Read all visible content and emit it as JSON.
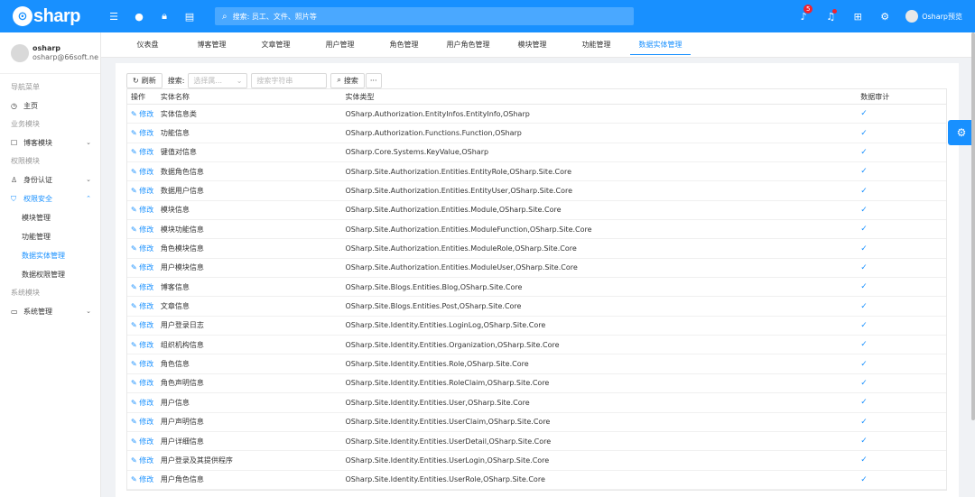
{
  "brand": {
    "logo_letter": "⊙",
    "name": "sharp"
  },
  "topbar": {
    "search_placeholder": "搜索: 员工、文件、照片等",
    "notification_count": "5",
    "user_name": "Osharp预览"
  },
  "sidebar": {
    "user": {
      "name": "osharp",
      "email": "osharp@66soft.ne"
    },
    "groups": {
      "nav": "导航菜单",
      "business": "业务模块",
      "permission": "权限模块",
      "system": "系统模块"
    },
    "items": {
      "home": "主页",
      "blog": "博客模块",
      "auth": "身份认证",
      "security": "权限安全",
      "system": "系统管理"
    },
    "sub_items": [
      "模块管理",
      "功能管理",
      "数据实体管理",
      "数据权限管理"
    ]
  },
  "tabs": [
    "仪表盘",
    "博客管理",
    "文章管理",
    "用户管理",
    "角色管理",
    "用户角色管理",
    "模块管理",
    "功能管理",
    "数据实体管理"
  ],
  "toolbar": {
    "refresh": "刷新",
    "search_label": "搜索:",
    "select_placeholder": "选择属...",
    "input_placeholder": "搜索字符串",
    "search_button": "搜索",
    "more": "···"
  },
  "table": {
    "headers": {
      "op": "操作",
      "name": "实体名称",
      "type": "实体类型",
      "audit": "数据审计"
    },
    "edit_label": "修改",
    "rows": [
      {
        "name": "实体信息类",
        "type": "OSharp.Authorization.EntityInfos.EntityInfo,OSharp"
      },
      {
        "name": "功能信息",
        "type": "OSharp.Authorization.Functions.Function,OSharp"
      },
      {
        "name": "键值对信息",
        "type": "OSharp.Core.Systems.KeyValue,OSharp"
      },
      {
        "name": "数据角色信息",
        "type": "OSharp.Site.Authorization.Entities.EntityRole,OSharp.Site.Core"
      },
      {
        "name": "数据用户信息",
        "type": "OSharp.Site.Authorization.Entities.EntityUser,OSharp.Site.Core"
      },
      {
        "name": "模块信息",
        "type": "OSharp.Site.Authorization.Entities.Module,OSharp.Site.Core"
      },
      {
        "name": "模块功能信息",
        "type": "OSharp.Site.Authorization.Entities.ModuleFunction,OSharp.Site.Core"
      },
      {
        "name": "角色模块信息",
        "type": "OSharp.Site.Authorization.Entities.ModuleRole,OSharp.Site.Core"
      },
      {
        "name": "用户模块信息",
        "type": "OSharp.Site.Authorization.Entities.ModuleUser,OSharp.Site.Core"
      },
      {
        "name": "博客信息",
        "type": "OSharp.Site.Blogs.Entities.Blog,OSharp.Site.Core"
      },
      {
        "name": "文章信息",
        "type": "OSharp.Site.Blogs.Entities.Post,OSharp.Site.Core"
      },
      {
        "name": "用户登录日志",
        "type": "OSharp.Site.Identity.Entities.LoginLog,OSharp.Site.Core"
      },
      {
        "name": "组织机构信息",
        "type": "OSharp.Site.Identity.Entities.Organization,OSharp.Site.Core"
      },
      {
        "name": "角色信息",
        "type": "OSharp.Site.Identity.Entities.Role,OSharp.Site.Core"
      },
      {
        "name": "角色声明信息",
        "type": "OSharp.Site.Identity.Entities.RoleClaim,OSharp.Site.Core"
      },
      {
        "name": "用户信息",
        "type": "OSharp.Site.Identity.Entities.User,OSharp.Site.Core"
      },
      {
        "name": "用户声明信息",
        "type": "OSharp.Site.Identity.Entities.UserClaim,OSharp.Site.Core"
      },
      {
        "name": "用户详细信息",
        "type": "OSharp.Site.Identity.Entities.UserDetail,OSharp.Site.Core"
      },
      {
        "name": "用户登录及其提供程序",
        "type": "OSharp.Site.Identity.Entities.UserLogin,OSharp.Site.Core"
      },
      {
        "name": "用户角色信息",
        "type": "OSharp.Site.Identity.Entities.UserRole,OSharp.Site.Core"
      }
    ]
  },
  "colors": {
    "primary": "#1890ff",
    "background": "#f0f2f5",
    "badge": "#f5222d"
  }
}
